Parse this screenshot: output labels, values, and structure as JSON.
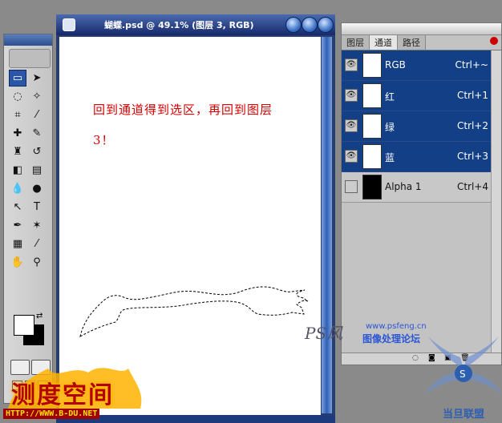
{
  "document": {
    "title": "蝴蝶.psd @ 49.1% (图层 3, RGB)",
    "canvas_text": "回到通道得到选区，再回到图层3！"
  },
  "toolbox": {
    "tools": [
      "marquee-tool",
      "move-tool",
      "lasso-tool",
      "magic-wand-tool",
      "crop-tool",
      "slice-tool",
      "healing-brush-tool",
      "brush-tool",
      "clone-stamp-tool",
      "history-brush-tool",
      "eraser-tool",
      "gradient-tool",
      "blur-tool",
      "dodge-tool",
      "path-selection-tool",
      "type-tool",
      "pen-tool",
      "shape-tool",
      "notes-tool",
      "eyedropper-tool",
      "hand-tool",
      "zoom-tool"
    ],
    "foreground_color": "#ffffff",
    "background_color": "#000000"
  },
  "channels_panel": {
    "tabs": [
      "图层",
      "通道",
      "路径"
    ],
    "active_tab": "通道",
    "rows": [
      {
        "name": "RGB",
        "shortcut": "Ctrl+~",
        "visible": true,
        "selected": true
      },
      {
        "name": "红",
        "shortcut": "Ctrl+1",
        "visible": true,
        "selected": true
      },
      {
        "name": "绿",
        "shortcut": "Ctrl+2",
        "visible": true,
        "selected": true
      },
      {
        "name": "蓝",
        "shortcut": "Ctrl+3",
        "visible": true,
        "selected": true
      },
      {
        "name": "Alpha 1",
        "shortcut": "Ctrl+4",
        "visible": false,
        "selected": false
      }
    ],
    "selection_color": "#123f86"
  },
  "watermarks": {
    "site_url": "www.psfeng.cn",
    "site_name": "图像处理论坛",
    "logo_text": "PS风",
    "brand_name": "测度空间",
    "brand_url": "HTTP://WWW.B-DU.NET",
    "corner_text": "当旦联盟"
  }
}
